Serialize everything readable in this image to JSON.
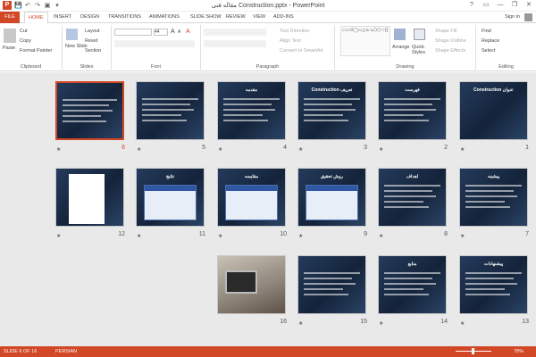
{
  "window": {
    "title": "مقاله فنی Construction.pptx - PowerPoint",
    "controls": [
      "?",
      "▭",
      "—",
      "❐",
      "✕"
    ]
  },
  "qat": {
    "app": "P",
    "save": "💾",
    "undo": "↶",
    "redo": "↷",
    "start": "▣",
    "more": "▾"
  },
  "tabs": [
    "FILE",
    "HOME",
    "INSERT",
    "DESIGN",
    "TRANSITIONS",
    "ANIMATIONS",
    "SLIDE SHOW",
    "REVIEW",
    "VIEW",
    "ADD-INS"
  ],
  "account": {
    "signin": "Sign in"
  },
  "ribbon": {
    "clipboard": {
      "paste": "Paste",
      "cut": "Cut",
      "copy": "Copy",
      "format_painter": "Format Painter",
      "label": "Clipboard"
    },
    "slides": {
      "new_slide": "New Slide",
      "layout": "Layout",
      "reset": "Reset",
      "section": "Section",
      "label": "Slides"
    },
    "font": {
      "size": "44",
      "grow": "A",
      "shrink": "A",
      "clear": "A",
      "label": "Font"
    },
    "paragraph": {
      "text_direction": "Text Direction",
      "align_text": "Align Text",
      "smartart": "Convert to SmartArt",
      "label": "Paragraph"
    },
    "drawing": {
      "shapes": "▭▭\\\\◯▭△↳↘⬠⬡☆{}",
      "arrange": "Arrange",
      "quick_styles": "Quick Styles",
      "shape_fill": "Shape Fill",
      "shape_outline": "Shape Outline",
      "shape_effects": "Shape Effects",
      "label": "Drawing"
    },
    "editing": {
      "find": "Find",
      "replace": "Replace",
      "select": "Select",
      "label": "Editing"
    }
  },
  "slides": [
    {
      "num": "1",
      "title": "Construction عنوان",
      "kind": "title"
    },
    {
      "num": "2",
      "title": "فهرست",
      "kind": "toc"
    },
    {
      "num": "3",
      "title": "Construction تعریف",
      "kind": "text"
    },
    {
      "num": "4",
      "title": "مقدمه",
      "kind": "text"
    },
    {
      "num": "5",
      "title": "",
      "kind": "text"
    },
    {
      "num": "6",
      "title": "",
      "kind": "text"
    },
    {
      "num": "7",
      "title": "پیشینه",
      "kind": "text"
    },
    {
      "num": "8",
      "title": "اهداف",
      "kind": "text"
    },
    {
      "num": "9",
      "title": "روش تحقیق",
      "kind": "table"
    },
    {
      "num": "10",
      "title": "مقایسه",
      "kind": "table"
    },
    {
      "num": "11",
      "title": "نتایج",
      "kind": "table"
    },
    {
      "num": "12",
      "title": "",
      "kind": "document"
    },
    {
      "num": "13",
      "title": "پیشنهادات",
      "kind": "text"
    },
    {
      "num": "14",
      "title": "منابع",
      "kind": "text"
    },
    {
      "num": "15",
      "title": "",
      "kind": "text"
    },
    {
      "num": "16",
      "title": "",
      "kind": "photo"
    }
  ],
  "status": {
    "slide": "SLIDE 6 OF 16",
    "language": "PERSIAN",
    "zoom": "78%"
  }
}
